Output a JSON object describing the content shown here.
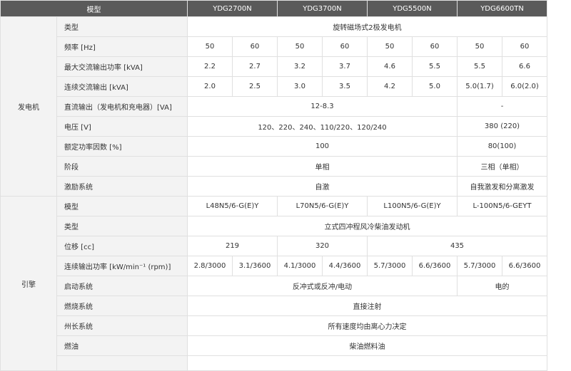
{
  "header": {
    "model_label": "模型",
    "models": [
      "YDG2700N",
      "YDG3700N",
      "YDG5500N",
      "YDG6600TN"
    ]
  },
  "groups": {
    "generator": "发电机",
    "engine": "引擎"
  },
  "generator_rows": {
    "type": {
      "label": "类型",
      "value": "旋转磁场式2极发电机"
    },
    "frequency": {
      "label": "频率 [Hz]",
      "values": [
        "50",
        "60",
        "50",
        "60",
        "50",
        "60",
        "50",
        "60"
      ]
    },
    "max_ac": {
      "label": "最大交流输出功率 [kVA]",
      "values": [
        "2.2",
        "2.7",
        "3.2",
        "3.7",
        "4.6",
        "5.5",
        "5.5",
        "6.6"
      ]
    },
    "cont_ac": {
      "label": "连续交流输出 [kVA]",
      "values": [
        "2.0",
        "2.5",
        "3.0",
        "3.5",
        "4.2",
        "5.0",
        "5.0(1.7)",
        "6.0(2.0)"
      ]
    },
    "dc": {
      "label": "直流输出（发电机和充电器）[VA]",
      "values": [
        "12-8.3",
        "-"
      ]
    },
    "voltage": {
      "label": "电压 [V]",
      "values": [
        "120、220、240、110/220、120/240",
        "380 (220)"
      ]
    },
    "power_factor": {
      "label": "额定功率因数 [%]",
      "values": [
        "100",
        "80(100)"
      ]
    },
    "phase": {
      "label": "阶段",
      "values": [
        "单相",
        "三相（单相）"
      ]
    },
    "excitation": {
      "label": "激励系统",
      "values": [
        "自激",
        "自我激发和分离激发"
      ]
    }
  },
  "engine_rows": {
    "model": {
      "label": "模型",
      "values": [
        "L48N5/6-G(E)Y",
        "L70N5/6-G(E)Y",
        "L100N5/6-G(E)Y",
        "L-100N5/6-GEYT"
      ]
    },
    "type": {
      "label": "类型",
      "value": "立式四冲程风冷柴油发动机"
    },
    "displacement": {
      "label": "位移 [cc]",
      "values": [
        "219",
        "320",
        "435"
      ]
    },
    "cont_power": {
      "label": "连续输出功率 [kW/min⁻¹ (rpm)]",
      "values": [
        "2.8/3000",
        "3.1/3600",
        "4.1/3000",
        "4.4/3600",
        "5.7/3000",
        "6.6/3600",
        "5.7/3000",
        "6.6/3600"
      ]
    },
    "start": {
      "label": "启动系统",
      "values": [
        "反冲式或反冲/电动",
        "电的"
      ]
    },
    "combustion": {
      "label": "燃烧系统",
      "value": "直接注射"
    },
    "governor": {
      "label": "州长系统",
      "value": "所有速度均由离心力决定"
    },
    "fuel": {
      "label": "燃油",
      "value": "柴油燃料油"
    }
  }
}
